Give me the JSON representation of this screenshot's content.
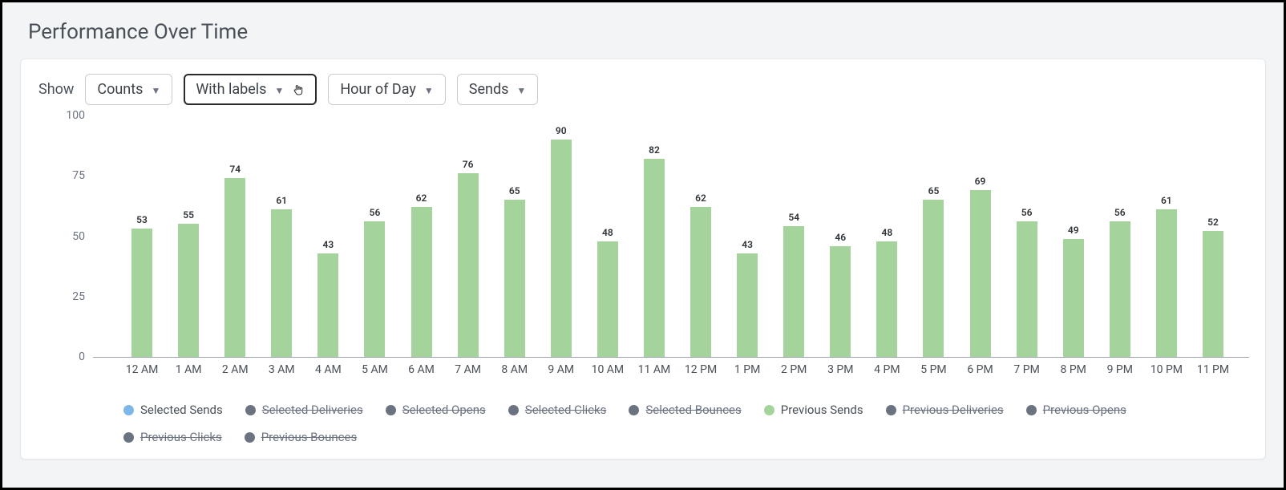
{
  "title": "Performance Over Time",
  "toolbar": {
    "show_label": "Show",
    "counts_label": "Counts",
    "with_labels_label": "With labels",
    "hour_of_day_label": "Hour of Day",
    "sends_label": "Sends"
  },
  "legend": {
    "selected_sends": "Selected Sends",
    "selected_deliveries": "Selected Deliveries",
    "selected_opens": "Selected Opens",
    "selected_clicks": "Selected Clicks",
    "selected_bounces": "Selected Bounces",
    "previous_sends": "Previous Sends",
    "previous_deliveries": "Previous Deliveries",
    "previous_opens": "Previous Opens",
    "previous_clicks": "Previous Clicks",
    "previous_bounces": "Previous Bounces"
  },
  "chart_data": {
    "type": "bar",
    "title": "Performance Over Time",
    "xlabel": "",
    "ylabel": "",
    "ylim": [
      0,
      100
    ],
    "yticks": [
      0,
      25,
      50,
      75,
      100
    ],
    "categories": [
      "12 AM",
      "1 AM",
      "2 AM",
      "3 AM",
      "4 AM",
      "5 AM",
      "6 AM",
      "7 AM",
      "8 AM",
      "9 AM",
      "10 AM",
      "11 AM",
      "12 PM",
      "1 PM",
      "2 PM",
      "3 PM",
      "4 PM",
      "5 PM",
      "6 PM",
      "7 PM",
      "8 PM",
      "9 PM",
      "10 PM",
      "11 PM"
    ],
    "series": [
      {
        "name": "Previous Sends",
        "color": "#a4d39c",
        "values": [
          53,
          55,
          74,
          61,
          43,
          56,
          62,
          76,
          65,
          90,
          48,
          82,
          62,
          43,
          54,
          46,
          48,
          65,
          69,
          56,
          49,
          56,
          61,
          52
        ]
      }
    ],
    "toggled_off_series": [
      "Selected Deliveries",
      "Selected Opens",
      "Selected Clicks",
      "Selected Bounces",
      "Previous Deliveries",
      "Previous Opens",
      "Previous Clicks",
      "Previous Bounces"
    ]
  }
}
